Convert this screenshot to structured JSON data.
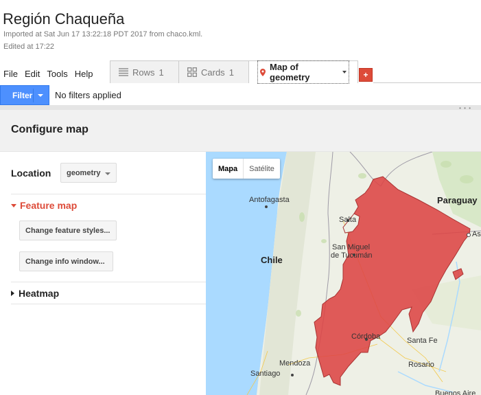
{
  "header": {
    "title": "Región Chaqueña",
    "imported": "Imported at Sat Jun 17 13:22:18 PDT 2017 from chaco.kml.",
    "edited": "Edited at 17:22"
  },
  "menu": [
    "File",
    "Edit",
    "Tools",
    "Help"
  ],
  "tabs": {
    "rows_label": "Rows",
    "rows_count": "1",
    "cards_label": "Cards",
    "cards_count": "1",
    "map_label": "Map of geometry",
    "add_label": "+"
  },
  "filter": {
    "button": "Filter",
    "status": "No filters applied"
  },
  "config": {
    "title": "Configure map",
    "location_label": "Location",
    "location_value": "geometry",
    "feature_map": "Feature map",
    "change_styles": "Change feature styles...",
    "change_info": "Change info window...",
    "heatmap": "Heatmap"
  },
  "map": {
    "type_map": "Mapa",
    "type_satellite": "Satélite",
    "labels": {
      "antofagasta": "Antofagasta",
      "salta": "Salta",
      "san_miguel": "San Miguel",
      "tucuman": "de Tucumán",
      "chile": "Chile",
      "paraguay": "Paraguay",
      "asuncion": "As",
      "cordoba": "Córdoba",
      "santa_fe": "Santa Fe",
      "mendoza": "Mendoza",
      "rosario": "Rosario",
      "santiago": "Santiago",
      "buenos_aires": "Buenos Aire"
    },
    "colors": {
      "ocean": "#aadaff",
      "land": "#eef0e6",
      "region_fill": "#dd4444",
      "region_stroke": "#a83232"
    }
  }
}
